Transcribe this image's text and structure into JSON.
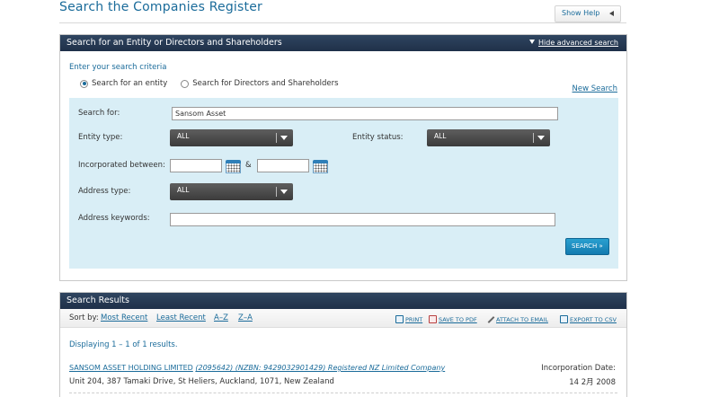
{
  "page": {
    "title": "Search the Companies Register",
    "help_label": "Show Help"
  },
  "search_panel": {
    "header": "Search for an Entity or Directors and Shareholders",
    "advanced_link": "Hide advanced search",
    "criteria_label": "Enter your search criteria",
    "radio_entity": "Search for an entity",
    "radio_directors": "Search for Directors and Shareholders",
    "selected_radio": "entity",
    "new_search": "New Search",
    "fields": {
      "search_for_label": "Search for:",
      "search_for_value": "Sansom Asset",
      "entity_type_label": "Entity type:",
      "entity_type_value": "ALL",
      "entity_status_label": "Entity status:",
      "entity_status_value": "ALL",
      "incorporated_label": "Incorporated between:",
      "incorporated_from": "",
      "incorporated_to": "",
      "amp": "&",
      "address_type_label": "Address type:",
      "address_type_value": "ALL",
      "address_keywords_label": "Address keywords:",
      "address_keywords_value": ""
    },
    "search_button": "SEARCH »"
  },
  "results_panel": {
    "header": "Search Results",
    "sort_label": "Sort by:",
    "sort_options": [
      "Most Recent",
      "Least Recent",
      "A–Z",
      "Z–A"
    ],
    "actions": {
      "print": "PRINT",
      "save_pdf": "SAVE TO PDF",
      "email": "ATTACH TO EMAIL",
      "csv": "EXPORT TO CSV"
    },
    "displaying": "Displaying 1 – 1 of 1 results.",
    "results": [
      {
        "name": "SANSOM ASSET HOLDING LIMITED",
        "extra": "(2095642) (NZBN: 9429032901429) Registered NZ Limited Company",
        "address": "Unit 204, 387 Tamaki Drive, St Heliers, Auckland, 1071, New Zealand",
        "inc_label": "Incorporation Date:",
        "inc_date": "14 2月 2008"
      }
    ]
  },
  "icons": {
    "help": "triangle-left-icon",
    "advanced": "triangle-down-icon",
    "calendar": "calendar-icon",
    "print": "printer-icon",
    "pdf": "pdf-icon",
    "email": "paperclip-icon",
    "csv": "spreadsheet-icon"
  },
  "colors": {
    "link": "#1a6b9a",
    "header_bg": "#2a3d56",
    "form_bg": "#d9eef6",
    "button": "#1b8cc0"
  }
}
